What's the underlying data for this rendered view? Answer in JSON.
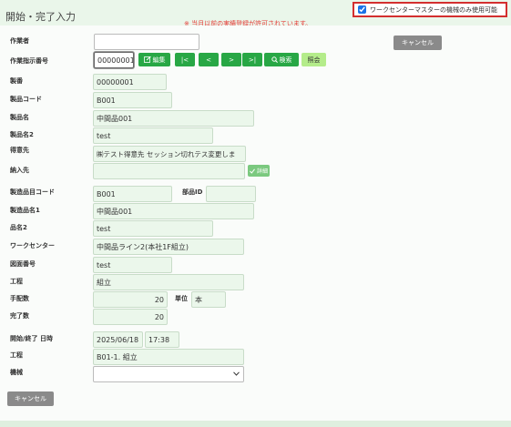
{
  "header": {
    "title": "開始・完了入力",
    "warning": "※ 当月以前の実績登録が許可されています。",
    "machine_master_label": "ワークセンターマスターの機械のみ使用可能",
    "machine_master_checked": true
  },
  "labels": {
    "worker": "作業者",
    "work_order_no": "作業指示番号",
    "serial": "製番",
    "product_code": "製品コード",
    "product_name": "製品名",
    "product_name2": "製品名2",
    "customer": "得意先",
    "delivery": "納入先",
    "manuf_item_code": "製造品目コード",
    "part_id": "部品ID",
    "manuf_item_name1": "製造品名1",
    "item_name2": "品名2",
    "work_center": "ワークセンター",
    "drawing_no": "図面番号",
    "process": "工程",
    "arranged_qty": "手配数",
    "unit": "単位",
    "completed_qty": "完了数",
    "start_end_datetime": "開始/終了 日時",
    "process2": "工程",
    "machine": "機械"
  },
  "values": {
    "worker": "",
    "work_order_no": "00000001",
    "serial": "00000001",
    "product_code": "B001",
    "product_name": "中間品001",
    "product_name2": "test",
    "customer": "㈱テスト得意先 セッション切れテス変更しま",
    "delivery": "",
    "manuf_item_code": "B001",
    "part_id": "",
    "manuf_item_name1": "中間品001",
    "item_name2": "test",
    "work_center": "中間品ライン2(本社1F組立)",
    "drawing_no": "test",
    "process": "組立",
    "arranged_qty": "20",
    "unit": "本",
    "completed_qty": "20",
    "date": "2025/06/18",
    "time": "17:38",
    "process_select": "B01-1. 組立",
    "machine": ""
  },
  "buttons": {
    "cancel_top": "キャンセル",
    "edit": "編集",
    "first": "|<",
    "prev": "<",
    "next": ">",
    "last": ">|",
    "search": "検索",
    "inquiry": "照会",
    "detail": "詳細",
    "cancel_bottom": "キャンセル"
  },
  "colors": {
    "accent_green": "#28a745",
    "field_bg": "#ebf7eb",
    "warning_red": "#e53935",
    "header_bg": "#eaf6ea"
  }
}
